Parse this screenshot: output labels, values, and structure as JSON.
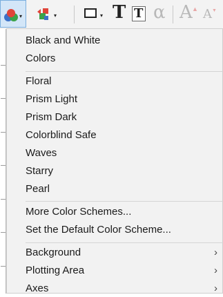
{
  "toolbar": {
    "items": [
      {
        "name": "color-scheme-button",
        "icon": "color-circles-icon",
        "has_dropdown": true,
        "active": true
      },
      {
        "name": "ordering-button",
        "icon": "shapes-order-icon",
        "has_dropdown": true
      },
      {
        "name": "border-button",
        "icon": "rectangle-border-icon",
        "has_dropdown": true
      },
      {
        "name": "text-button",
        "icon": "text-T-icon",
        "glyph": "T"
      },
      {
        "name": "text-box-button",
        "icon": "text-box-T-icon",
        "glyph": "T"
      },
      {
        "name": "symbol-button",
        "icon": "alpha-symbol-icon",
        "glyph": "α",
        "disabled": true
      },
      {
        "name": "grow-font-button",
        "icon": "grow-font-icon",
        "glyph": "A",
        "mark": "▲",
        "disabled": true
      },
      {
        "name": "shrink-font-button",
        "icon": "shrink-font-icon",
        "glyph": "A",
        "mark": "▼",
        "disabled": true
      }
    ],
    "dropdown_arrow": "▾"
  },
  "menu": {
    "groups": [
      {
        "items": [
          {
            "label": "Black and White"
          },
          {
            "label": "Colors"
          }
        ]
      },
      {
        "items": [
          {
            "label": "Floral"
          },
          {
            "label": "Prism Light"
          },
          {
            "label": "Prism Dark"
          },
          {
            "label": "Colorblind Safe"
          },
          {
            "label": "Waves"
          },
          {
            "label": "Starry"
          },
          {
            "label": "Pearl"
          }
        ]
      },
      {
        "items": [
          {
            "label": "More Color Schemes..."
          },
          {
            "label": "Set the Default Color Scheme..."
          }
        ]
      },
      {
        "items": [
          {
            "label": "Background",
            "submenu": true
          },
          {
            "label": "Plotting Area",
            "submenu": true
          },
          {
            "label": "Axes",
            "submenu": true
          }
        ]
      }
    ],
    "submenu_glyph": "›"
  },
  "colors": {
    "active_button_bg": "#d3e6f8",
    "active_button_border": "#7aaede",
    "menu_bg": "#f2f2f2",
    "disabled_glyph": "#b8b8b8",
    "circle_red": "#e0453a",
    "circle_green": "#3aa34a",
    "circle_blue": "#3d72c8"
  }
}
